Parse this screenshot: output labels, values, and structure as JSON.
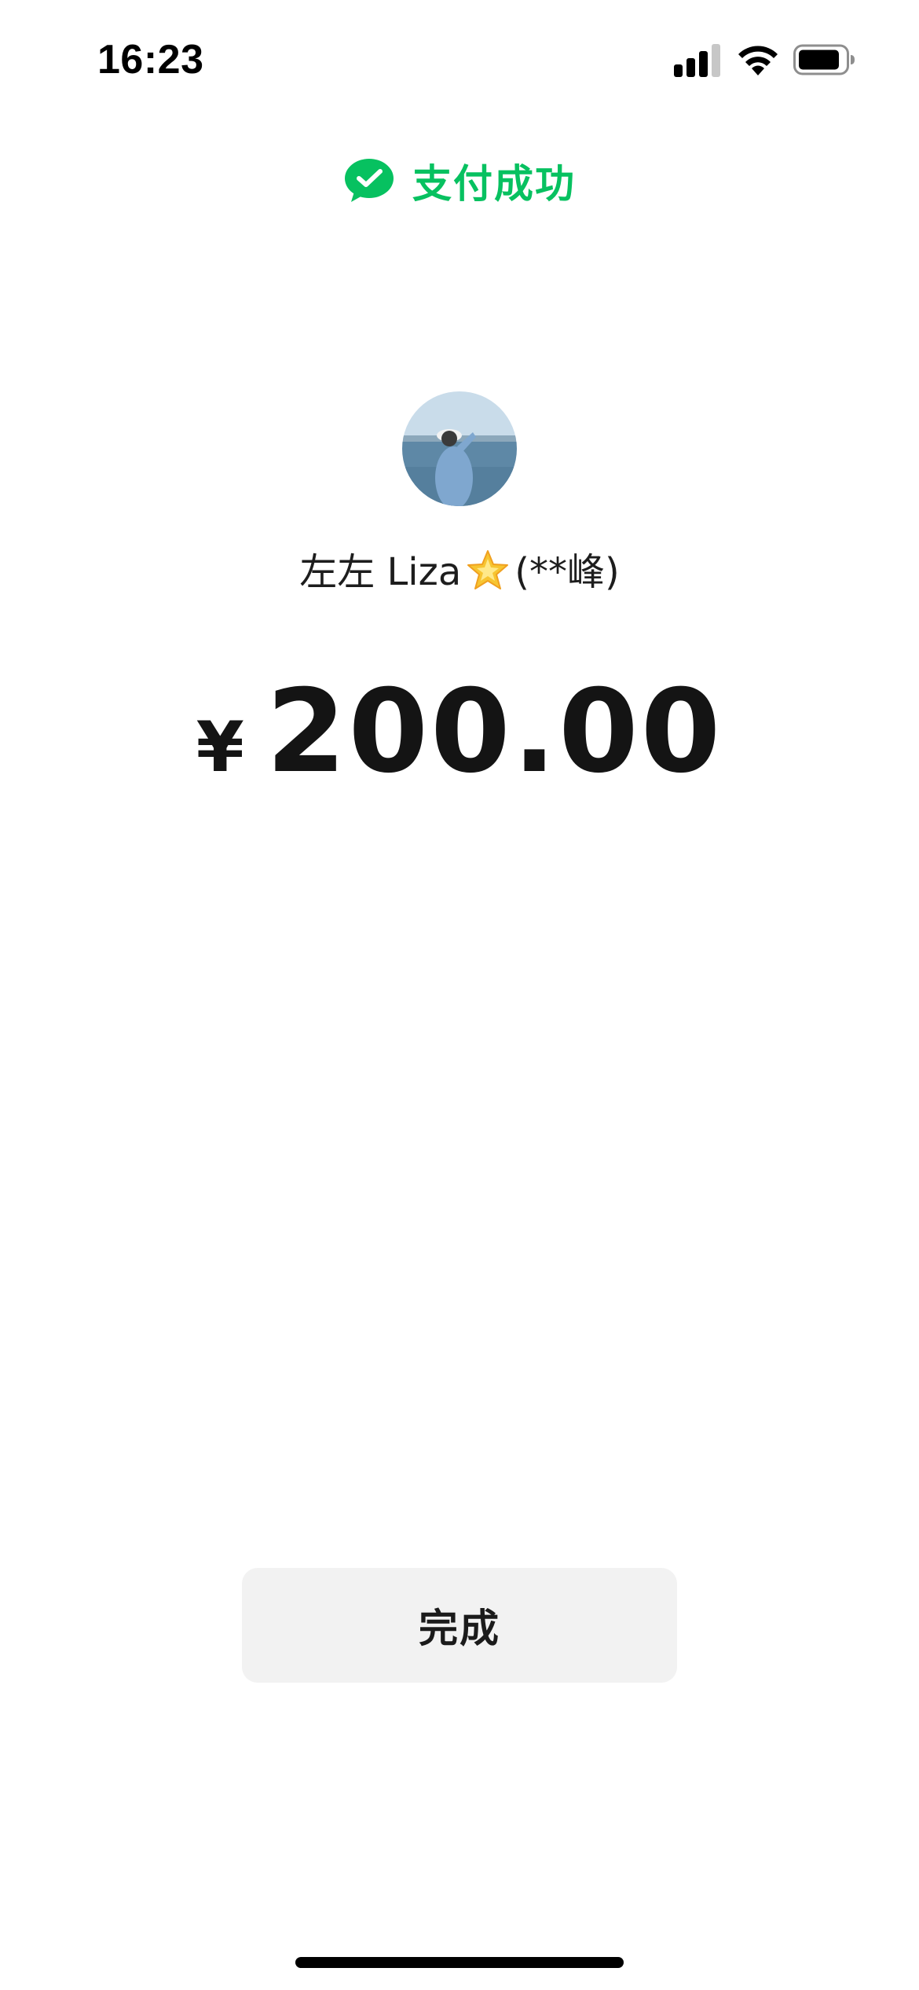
{
  "status_bar": {
    "time": "16:23",
    "icons": [
      "cellular-signal-icon",
      "wifi-icon",
      "battery-icon"
    ]
  },
  "header": {
    "icon": "wechat-pay-icon",
    "title": "支付成功",
    "accent_color": "#07c160"
  },
  "payee": {
    "avatar": "avatar-photo",
    "name": "左左 Liza",
    "name_emoji": "star-icon",
    "real_name_masked": "(**峰)"
  },
  "payment": {
    "currency_symbol": "¥",
    "amount": "200.00"
  },
  "actions": {
    "done_label": "完成"
  }
}
